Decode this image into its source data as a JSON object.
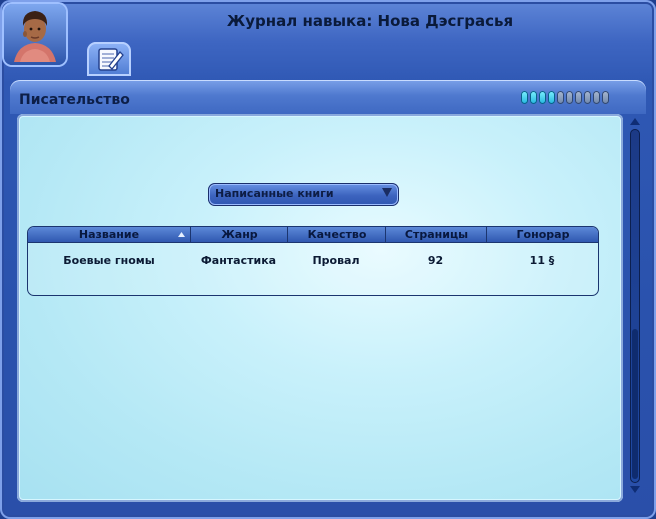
{
  "window": {
    "title": "Журнал навыка: Нова Дэсграсья"
  },
  "tabs": [
    {
      "icon": "notebook-pencil-icon"
    }
  ],
  "skill_panel": {
    "title": "Писательство",
    "level_current": 4,
    "level_max": 10
  },
  "dropdown": {
    "selected": "Написанные книги"
  },
  "table": {
    "columns": [
      "Название",
      "Жанр",
      "Качество",
      "Страницы",
      "Гонорар"
    ],
    "sort_column": "Название",
    "rows": [
      [
        "Боевые гномы",
        "Фантастика",
        "Провал",
        "92",
        "11 §"
      ]
    ]
  },
  "colors": {
    "window_blue": "#2f58b4",
    "content_cyan": "#c9f1fb",
    "skill_pip_active": "#22b5de"
  }
}
